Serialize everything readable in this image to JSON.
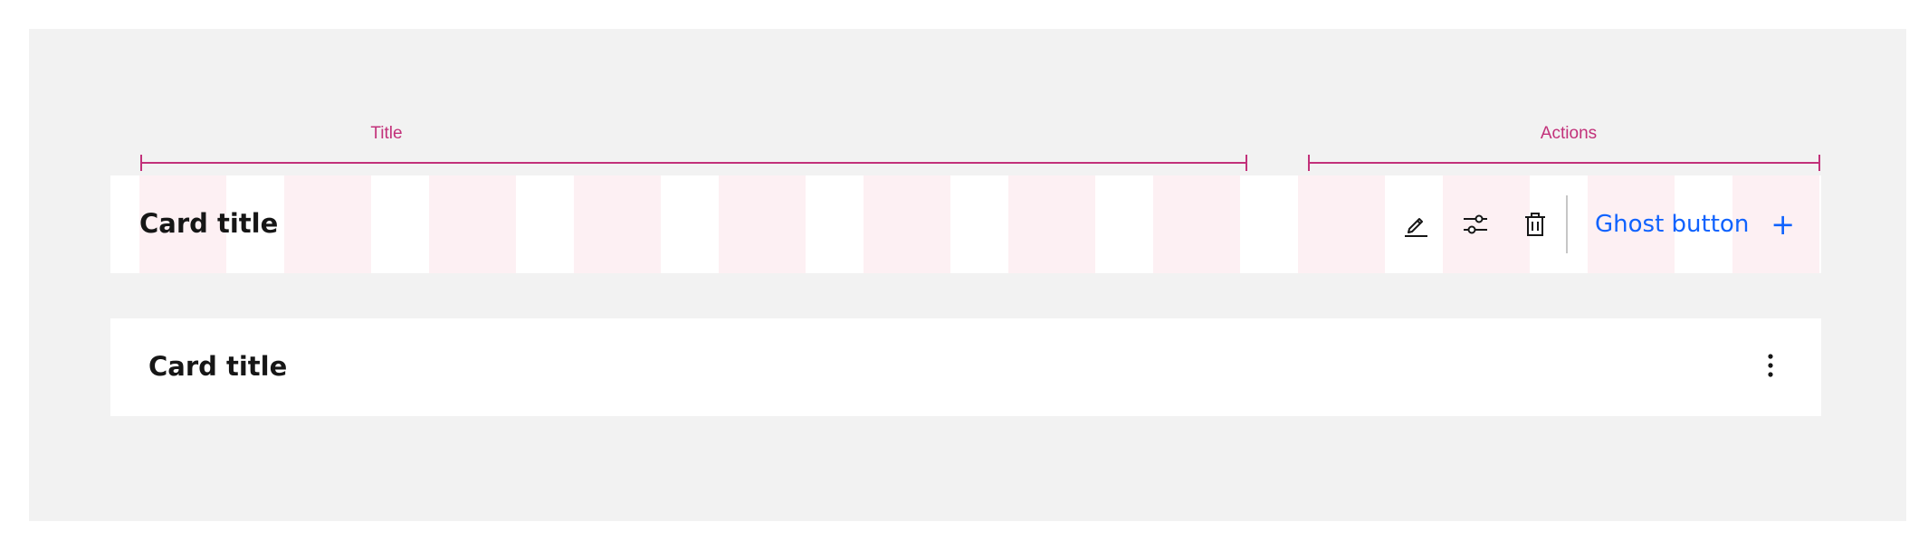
{
  "annotations": {
    "title_label": "Title",
    "actions_label": "Actions",
    "color": "#c2317a"
  },
  "card_with_actions": {
    "title": "Card title",
    "icons": [
      "edit-icon",
      "settings-adjust-icon",
      "trash-can-icon"
    ],
    "ghost_button": {
      "label": "Ghost button",
      "icon": "add-icon"
    }
  },
  "card_with_overflow": {
    "title": "Card title",
    "icon": "overflow-menu-vertical-icon"
  },
  "colors": {
    "background": "#f2f2f2",
    "card": "#ffffff",
    "grid_column": "#fdf0f3",
    "text": "#161616",
    "link": "#0f62fe",
    "annotation": "#c2317a"
  }
}
